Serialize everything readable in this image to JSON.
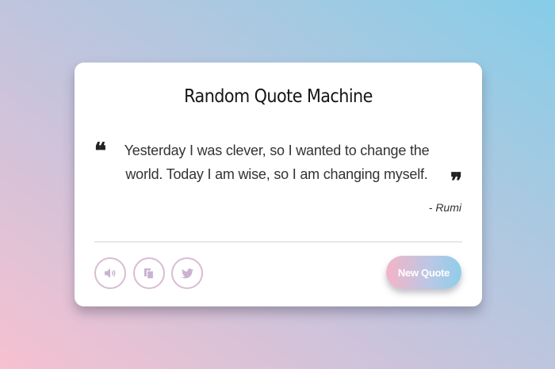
{
  "card": {
    "title": "Random Quote Machine",
    "quote": "Yesterday I was clever, so I wanted to change the world. Today I am wise, so I am changing myself.",
    "author": "- Rumi",
    "open_mark": "❝",
    "close_mark": "❞"
  },
  "actions": {
    "speak_icon": "volume-icon",
    "copy_icon": "copy-icon",
    "tweet_icon": "twitter-icon",
    "new_quote_label": "New Quote"
  },
  "colors": {
    "icon_border": "#d9bcd2",
    "icon_fill": "#c9b3cf",
    "button_gradient_start": "#f4b4c6",
    "button_gradient_end": "#8fcde8"
  }
}
